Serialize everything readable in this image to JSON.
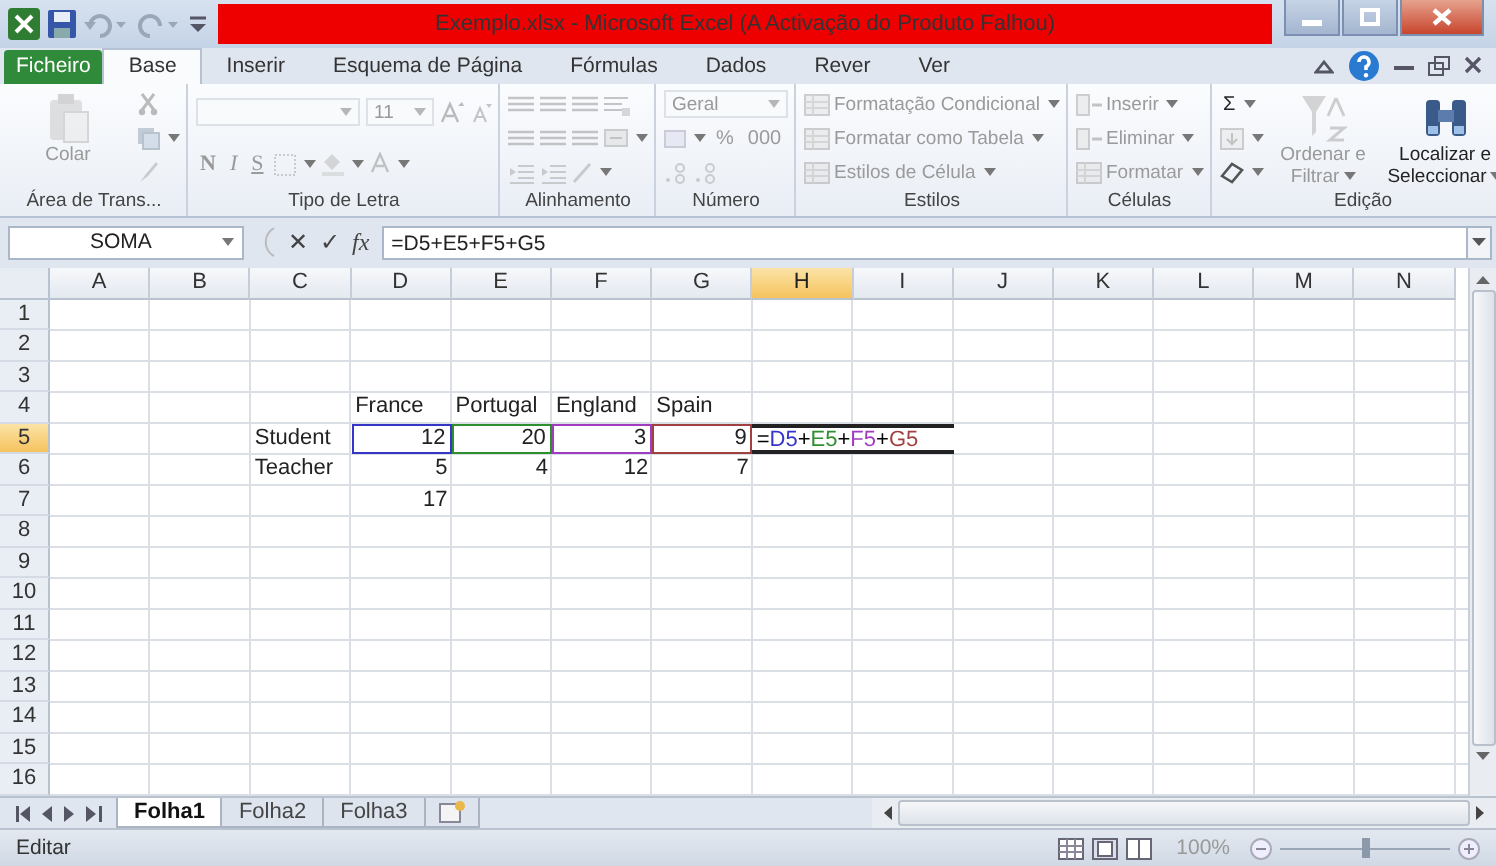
{
  "window": {
    "title": "Exemplo.xlsx  -  Microsoft Excel (A Activação do Produto Falhou)"
  },
  "tabs": [
    {
      "label": "Ficheiro",
      "kind": "file",
      "selected": false
    },
    {
      "label": "Base",
      "kind": "tab",
      "selected": true
    },
    {
      "label": "Inserir",
      "kind": "tab",
      "selected": false
    },
    {
      "label": "Esquema de Página",
      "kind": "tab",
      "selected": false
    },
    {
      "label": "Fórmulas",
      "kind": "tab",
      "selected": false
    },
    {
      "label": "Dados",
      "kind": "tab",
      "selected": false
    },
    {
      "label": "Rever",
      "kind": "tab",
      "selected": false
    },
    {
      "label": "Ver",
      "kind": "tab",
      "selected": false
    }
  ],
  "ribbon": [
    {
      "label": "Área de Trans...",
      "columns": [
        {
          "kind": "big",
          "label": "Colar",
          "disabled": true
        },
        {
          "kind": "stack",
          "rows": [
            [
              {
                "kind": "icon",
                "disabled": true
              }
            ],
            [
              {
                "kind": "icon",
                "disabled": true
              }
            ],
            [
              {
                "kind": "icon",
                "disabled": true
              }
            ]
          ]
        }
      ]
    },
    {
      "label": "Tipo de Letra",
      "columns": [
        {
          "kind": "stack",
          "rows": [
            [
              {
                "kind": "combo",
                "disabled": true
              },
              {
                "kind": "combo",
                "value": "11",
                "disabled": true
              },
              {
                "kind": "icon",
                "disabled": true
              },
              {
                "kind": "icon",
                "disabled": true
              }
            ],
            [
              {
                "kind": "letter",
                "label": "N",
                "disabled": true
              },
              {
                "kind": "letter",
                "label": "I",
                "disabled": true
              },
              {
                "kind": "letter",
                "label": "S",
                "disabled": true
              },
              {
                "kind": "icon",
                "disabled": true
              },
              {
                "kind": "icon",
                "disabled": true
              },
              {
                "kind": "icon",
                "disabled": true
              }
            ]
          ]
        }
      ]
    },
    {
      "label": "Alinhamento",
      "columns": [
        {
          "kind": "stack",
          "rows": [
            [
              {
                "kind": "icon",
                "disabled": true
              },
              {
                "kind": "icon",
                "disabled": true
              },
              {
                "kind": "icon",
                "disabled": true
              },
              {
                "kind": "icon",
                "disabled": true
              }
            ],
            [
              {
                "kind": "icon",
                "disabled": true
              },
              {
                "kind": "icon",
                "disabled": true
              },
              {
                "kind": "icon",
                "disabled": true
              },
              {
                "kind": "icon",
                "disabled": true
              }
            ],
            [
              {
                "kind": "icon",
                "disabled": true
              },
              {
                "kind": "icon",
                "disabled": true
              },
              {
                "kind": "icon",
                "disabled": true
              }
            ]
          ]
        }
      ]
    },
    {
      "label": "Número",
      "columns": [
        {
          "kind": "stack",
          "rows": [
            [
              {
                "kind": "combo",
                "value": "Geral",
                "disabled": true
              }
            ],
            [
              {
                "kind": "icon",
                "disabled": true
              },
              {
                "kind": "letter",
                "label": "%",
                "disabled": true
              },
              {
                "kind": "letter",
                "label": "000",
                "disabled": true
              }
            ],
            [
              {
                "kind": "icon",
                "disabled": true
              },
              {
                "kind": "icon",
                "disabled": true
              }
            ]
          ]
        }
      ]
    },
    {
      "label": "Estilos",
      "columns": [
        {
          "kind": "stack",
          "rows": [
            [
              {
                "kind": "menu",
                "label": "Formatação Condicional",
                "disabled": true
              }
            ],
            [
              {
                "kind": "menu",
                "label": "Formatar como Tabela",
                "disabled": true
              }
            ],
            [
              {
                "kind": "menu",
                "label": "Estilos de Célula",
                "disabled": true
              }
            ]
          ]
        }
      ]
    },
    {
      "label": "Células",
      "columns": [
        {
          "kind": "stack",
          "rows": [
            [
              {
                "kind": "menu",
                "label": "Inserir",
                "disabled": true
              }
            ],
            [
              {
                "kind": "menu",
                "label": "Eliminar",
                "disabled": true
              }
            ],
            [
              {
                "kind": "menu",
                "label": "Formatar",
                "disabled": true
              }
            ]
          ]
        }
      ]
    },
    {
      "label": "Edição",
      "columns": [
        {
          "kind": "stack",
          "rows": [
            [
              {
                "kind": "letter",
                "label": "Σ",
                "disabled": false
              }
            ],
            [
              {
                "kind": "icon",
                "disabled": true
              }
            ],
            [
              {
                "kind": "icon",
                "disabled": false
              }
            ]
          ]
        },
        {
          "kind": "big",
          "label": "Ordenar e Filtrar",
          "disabled": true
        },
        {
          "kind": "big",
          "label": "Localizar e Seleccionar",
          "disabled": false
        }
      ]
    }
  ],
  "formula_bar": {
    "name_box": "SOMA",
    "cancel": "✕",
    "enter": "✓",
    "function": "fx",
    "formula": "=D5+E5+F5+G5"
  },
  "columns": [
    {
      "label": "A",
      "selected": false
    },
    {
      "label": "B",
      "selected": false
    },
    {
      "label": "C",
      "selected": false
    },
    {
      "label": "D",
      "selected": false
    },
    {
      "label": "E",
      "selected": false
    },
    {
      "label": "F",
      "selected": false
    },
    {
      "label": "G",
      "selected": false
    },
    {
      "label": "H",
      "selected": true
    },
    {
      "label": "I",
      "selected": false
    },
    {
      "label": "J",
      "selected": false
    },
    {
      "label": "K",
      "selected": false
    },
    {
      "label": "L",
      "selected": false
    },
    {
      "label": "M",
      "selected": false
    },
    {
      "label": "N",
      "selected": false
    }
  ],
  "rows": [
    {
      "label": "1",
      "selected": false
    },
    {
      "label": "2",
      "selected": false
    },
    {
      "label": "3",
      "selected": false
    },
    {
      "label": "4",
      "selected": false,
      "cells": [
        null,
        null,
        null,
        {
          "kind": "text",
          "text": "France"
        },
        {
          "kind": "text",
          "text": "Portugal"
        },
        {
          "kind": "text",
          "text": "England"
        },
        {
          "kind": "text",
          "text": "Spain"
        }
      ]
    },
    {
      "label": "5",
      "selected": true,
      "cells": [
        null,
        null,
        {
          "kind": "text",
          "text": "Student"
        },
        {
          "kind": "number",
          "text": "12",
          "color": "#3535c8"
        },
        {
          "kind": "number",
          "text": "20",
          "color": "#2e8f2e"
        },
        {
          "kind": "number",
          "text": "3",
          "color": "#a03cc0"
        },
        {
          "kind": "number",
          "text": "9",
          "color": "#a04040"
        },
        {
          "kind": "formula",
          "parts": [
            {
              "text": "=",
              "color": "#000000"
            },
            {
              "text": "D5",
              "color": "#3535c8"
            },
            {
              "text": "+",
              "color": "#000000"
            },
            {
              "text": "E5",
              "color": "#2e8f2e"
            },
            {
              "text": "+",
              "color": "#000000"
            },
            {
              "text": "F5",
              "color": "#a03cc0"
            },
            {
              "text": "+",
              "color": "#000000"
            },
            {
              "text": "G5",
              "color": "#a04040"
            }
          ]
        }
      ]
    },
    {
      "label": "6",
      "selected": false,
      "cells": [
        null,
        null,
        {
          "kind": "text",
          "text": "Teacher"
        },
        {
          "kind": "number",
          "text": "5"
        },
        {
          "kind": "number",
          "text": "4"
        },
        {
          "kind": "number",
          "text": "12"
        },
        {
          "kind": "number",
          "text": "7"
        }
      ]
    },
    {
      "label": "7",
      "selected": false,
      "cells": [
        null,
        null,
        null,
        {
          "kind": "number",
          "text": "17"
        }
      ]
    },
    {
      "label": "8",
      "selected": false
    },
    {
      "label": "9",
      "selected": false
    },
    {
      "label": "10",
      "selected": false
    },
    {
      "label": "11",
      "selected": false
    },
    {
      "label": "12",
      "selected": false
    },
    {
      "label": "13",
      "selected": false
    },
    {
      "label": "14",
      "selected": false
    },
    {
      "label": "15",
      "selected": false
    },
    {
      "label": "16",
      "selected": false
    }
  ],
  "sheets": [
    {
      "label": "Folha1",
      "selected": true
    },
    {
      "label": "Folha2",
      "selected": false
    },
    {
      "label": "Folha3",
      "selected": false
    }
  ],
  "status_bar": {
    "mode": "Editar",
    "zoom": "100%",
    "zoom_slider": {
      "level": 0.5
    }
  }
}
